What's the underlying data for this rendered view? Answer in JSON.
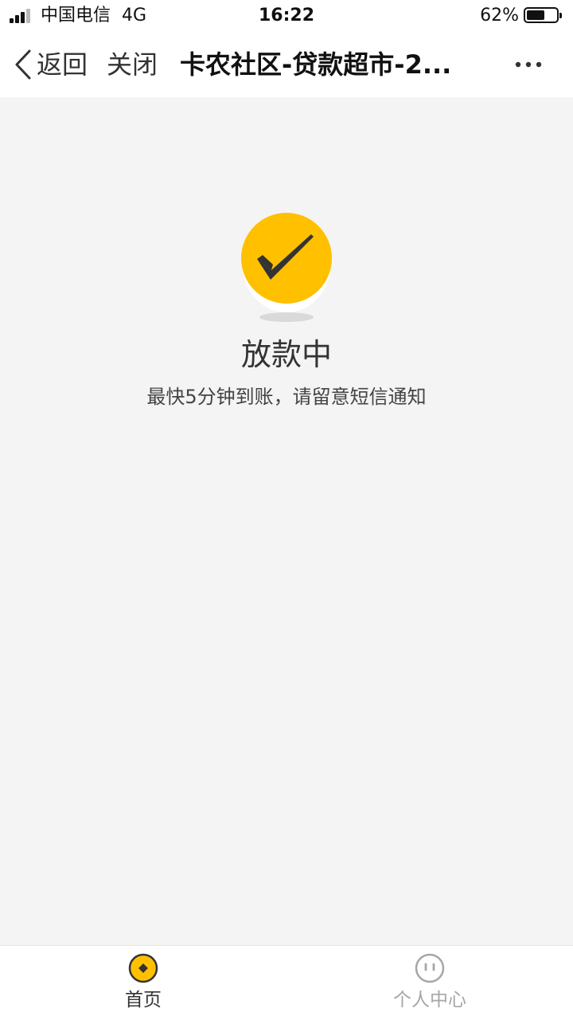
{
  "status_bar": {
    "carrier": "中国电信",
    "network": "4G",
    "time": "16:22",
    "battery_percent": "62%",
    "battery_level": 0.62,
    "signal_bars": 4,
    "signal_bars_filled": 3
  },
  "nav": {
    "back_label": "返回",
    "close_label": "关闭",
    "title": "卡农社区-贷款超市-2...",
    "back_icon": "chevron-left-icon",
    "more_icon": "more-horizontal-icon"
  },
  "result": {
    "icon": "check-circle-icon",
    "title": "放款中",
    "description": "最快5分钟到账，请留意短信通知"
  },
  "tabbar": {
    "items": [
      {
        "label": "首页",
        "icon": "home-coin-icon",
        "active": true
      },
      {
        "label": "个人中心",
        "icon": "profile-face-icon",
        "active": false
      }
    ]
  },
  "colors": {
    "accent": "#FFC000",
    "check": "#333333",
    "background": "#F4F4F4",
    "inactive": "#A6A6A6"
  }
}
